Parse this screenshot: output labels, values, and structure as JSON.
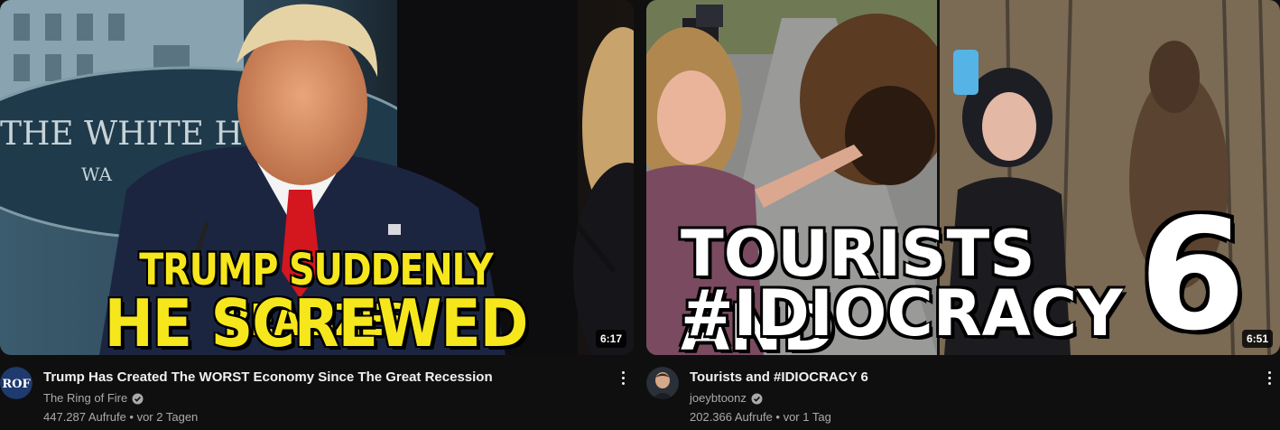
{
  "videos": [
    {
      "title": "Trump Has Created The WORST Economy Since The Great Recession",
      "channel": "The Ring of Fire",
      "verified": true,
      "meta": "447.287 Aufrufe • vor 2 Tagen",
      "duration": "6:17",
      "avatar_text": "ROF",
      "thumb_line1": "TRUMP SUDDENLY REALIZES",
      "thumb_line2": "HE SCREWED UP",
      "thumb_sign": "THE WHITE H",
      "thumb_sign2": "WA"
    },
    {
      "title": "Tourists and #IDIOCRACY 6",
      "channel": "joeybtoonz",
      "verified": true,
      "meta": "202.366 Aufrufe • vor 1 Tag",
      "duration": "6:51",
      "thumb_line1": "TOURISTS AND",
      "thumb_line2": "#IDIOCRACY",
      "thumb_number": "6"
    }
  ],
  "icons": {
    "menu": "more-vert-icon",
    "verified": "verified-check-icon"
  },
  "colors": {
    "background": "#0f0f0f",
    "title_text": "#f1f1f1",
    "secondary_text": "#aaaaaa",
    "thumb_headline_yellow": "#f6e71d"
  }
}
